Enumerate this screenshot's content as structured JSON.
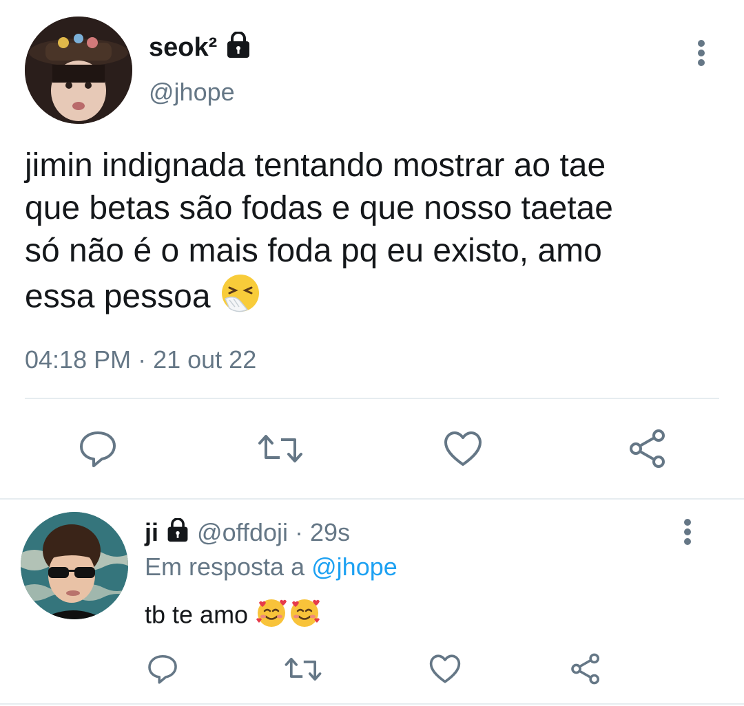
{
  "tweet": {
    "display_name": "seok²",
    "handle": "@jhope",
    "text_lines": [
      "jimin indignada tentando mostrar ao tae",
      "que betas são fodas e que nosso taetae",
      "só não é o mais foda pq eu existo, amo",
      "essa pessoa"
    ],
    "timestamp": "04:18 PM · 21 out 22",
    "emoji": "sneezing-face"
  },
  "reply": {
    "display_name": "ji",
    "handle": "@offdoji",
    "age": "· 29s",
    "in_reply_prefix": "Em resposta a",
    "in_reply_handle": "@jhope",
    "text": "tb te amo",
    "emojis": [
      "smiling-face-with-hearts",
      "smiling-face-with-hearts"
    ]
  },
  "colors": {
    "text": "#14171a",
    "muted": "#657786",
    "link": "#1da1f2",
    "divider": "#e6ecf0"
  },
  "icons": [
    "more-icon",
    "reply-icon",
    "retweet-icon",
    "like-icon",
    "share-icon",
    "lock-icon"
  ]
}
